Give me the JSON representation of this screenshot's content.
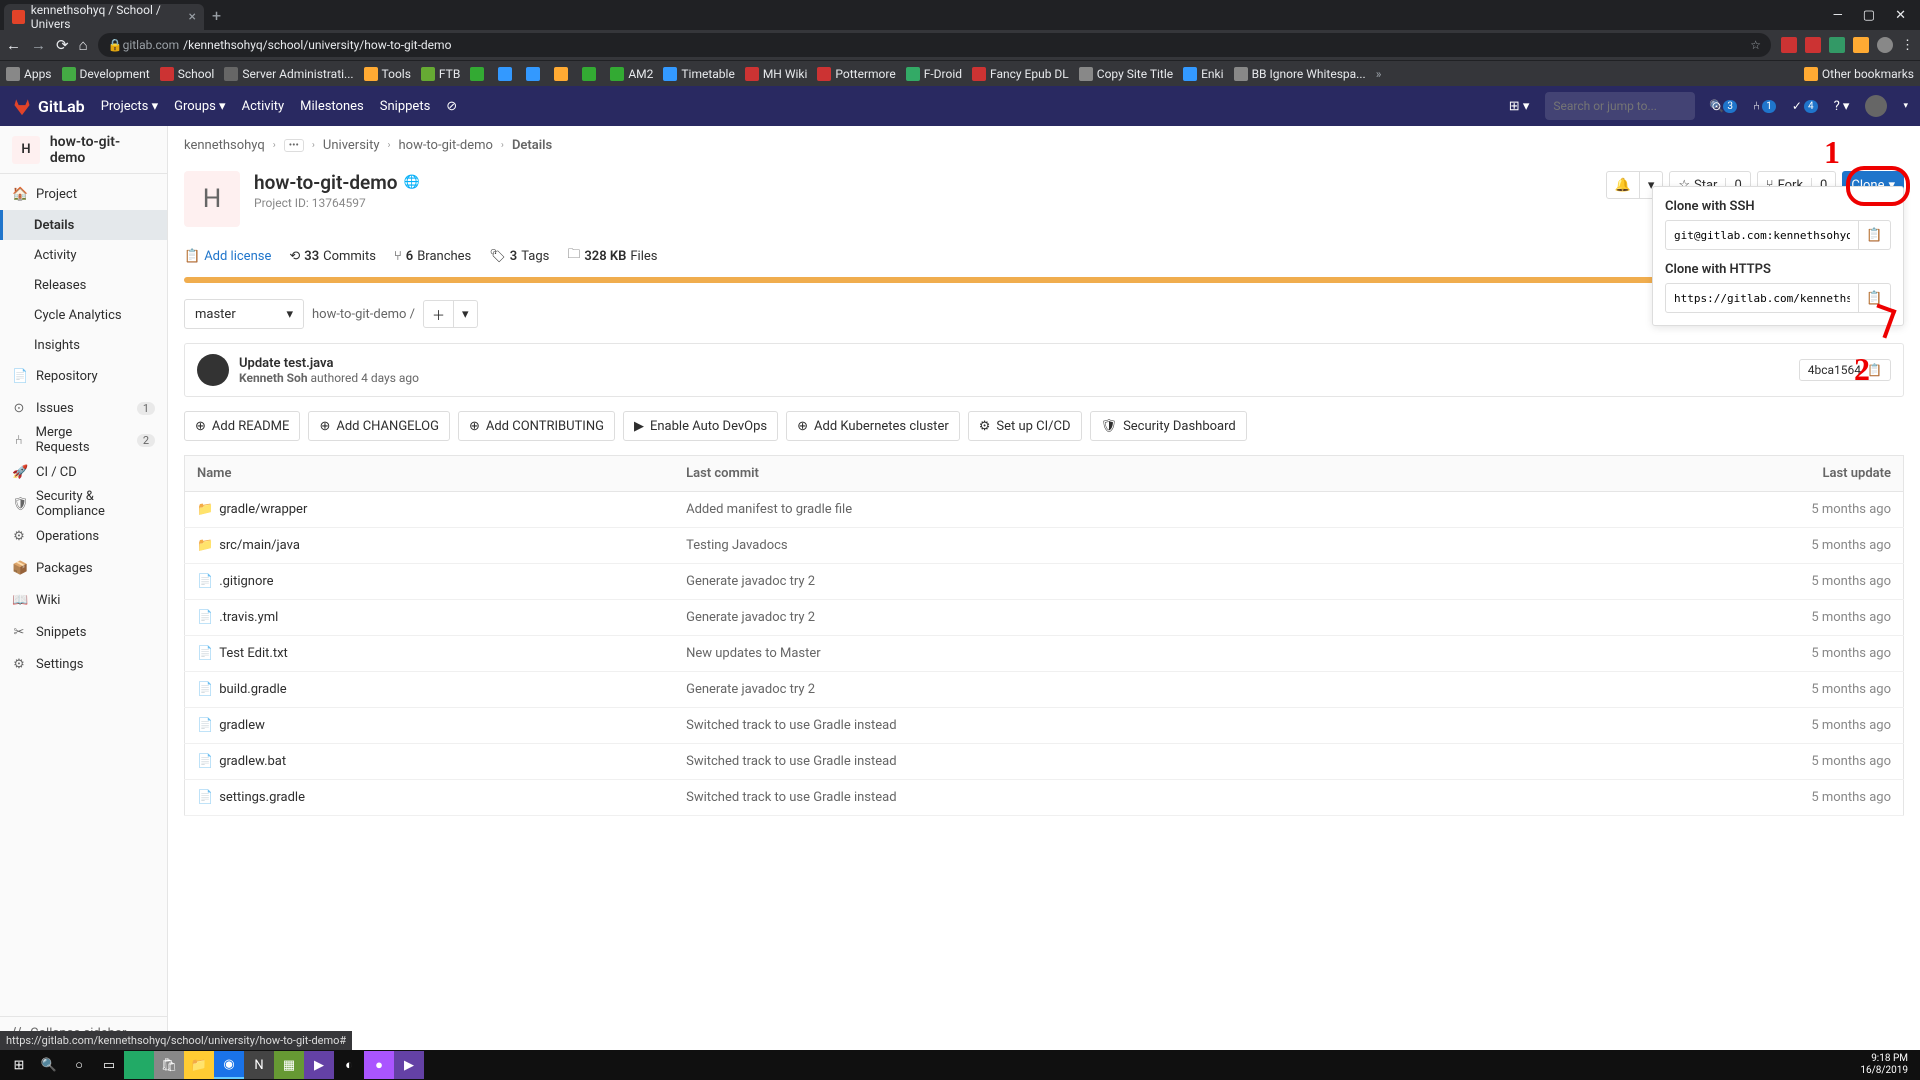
{
  "browser": {
    "tab_title": "kennethsohyq / School / Univers",
    "url_host": "gitlab.com",
    "url_path": "/kennethsohyq/school/university/how-to-git-demo",
    "bookmarks": [
      "Apps",
      "Development",
      "School",
      "Server Administrati...",
      "Tools",
      "FTB",
      "",
      "",
      "",
      "",
      "",
      "AM2",
      "Timetable",
      "MH Wiki",
      "Pottermore",
      "F-Droid",
      "Fancy Epub DL",
      "Copy Site Title",
      "Enki",
      "BB Ignore Whitespa..."
    ],
    "other_bookmarks": "Other bookmarks",
    "status_url": "https://gitlab.com/kennethsohyq/school/university/how-to-git-demo#"
  },
  "gl_header": {
    "brand": "GitLab",
    "nav": [
      "Projects",
      "Groups",
      "Activity",
      "Milestones",
      "Snippets"
    ],
    "search_placeholder": "Search or jump to...",
    "issues_count": "3",
    "mr_count": "1",
    "todo_count": "4"
  },
  "sidebar": {
    "project_initial": "H",
    "project_name": "how-to-git-demo",
    "items": [
      {
        "label": "Project",
        "icon": "🏠"
      },
      {
        "label": "Details",
        "sub": true,
        "active": true
      },
      {
        "label": "Activity",
        "sub": true
      },
      {
        "label": "Releases",
        "sub": true
      },
      {
        "label": "Cycle Analytics",
        "sub": true
      },
      {
        "label": "Insights",
        "sub": true
      },
      {
        "label": "Repository",
        "icon": "📄"
      },
      {
        "label": "Issues",
        "icon": "⊙",
        "badge": "1"
      },
      {
        "label": "Merge Requests",
        "icon": "⑃",
        "badge": "2"
      },
      {
        "label": "CI / CD",
        "icon": "🚀"
      },
      {
        "label": "Security & Compliance",
        "icon": "🛡"
      },
      {
        "label": "Operations",
        "icon": "⚙"
      },
      {
        "label": "Packages",
        "icon": "📦"
      },
      {
        "label": "Wiki",
        "icon": "📖"
      },
      {
        "label": "Snippets",
        "icon": "✂"
      },
      {
        "label": "Settings",
        "icon": "⚙"
      }
    ],
    "collapse": "Collapse sidebar"
  },
  "breadcrumbs": [
    "kennethsohyq",
    "...",
    "University",
    "how-to-git-demo",
    "Details"
  ],
  "project": {
    "initial": "H",
    "title": "how-to-git-demo",
    "id": "Project ID: 13764597",
    "star": "Star",
    "star_count": "0",
    "fork": "Fork",
    "fork_count": "0",
    "clone": "Clone",
    "notification_icon": "🔔"
  },
  "stats": {
    "add_license": "Add license",
    "commits_n": "33",
    "commits_l": "Commits",
    "branches_n": "6",
    "branches_l": "Branches",
    "tags_n": "3",
    "tags_l": "Tags",
    "size_n": "328 KB",
    "size_l": "Files"
  },
  "tree": {
    "branch": "master",
    "crumb": "how-to-git-demo",
    "sep": "/"
  },
  "commit": {
    "msg": "Update test.java",
    "author": "Kenneth Soh",
    "verb": "authored",
    "when": "4 days ago",
    "sha": "4bca1564"
  },
  "quick_actions": [
    "Add README",
    "Add CHANGELOG",
    "Add CONTRIBUTING",
    "Enable Auto DevOps",
    "Add Kubernetes cluster",
    "Set up CI/CD",
    "Security Dashboard"
  ],
  "table": {
    "headers": [
      "Name",
      "Last commit",
      "Last update"
    ],
    "rows": [
      {
        "icon": "📁",
        "name": "gradle/wrapper",
        "commit": "Added manifest to gradle file",
        "when": "5 months ago"
      },
      {
        "icon": "📁",
        "name": "src/main/java",
        "commit": "Testing Javadocs",
        "when": "5 months ago"
      },
      {
        "icon": "📄",
        "name": ".gitignore",
        "commit": "Generate javadoc try 2",
        "when": "5 months ago"
      },
      {
        "icon": "📄",
        "name": ".travis.yml",
        "commit": "Generate javadoc try 2",
        "when": "5 months ago"
      },
      {
        "icon": "📄",
        "name": "Test Edit.txt",
        "commit": "New updates to Master",
        "when": "5 months ago"
      },
      {
        "icon": "📄",
        "name": "build.gradle",
        "commit": "Generate javadoc try 2",
        "when": "5 months ago"
      },
      {
        "icon": "📄",
        "name": "gradlew",
        "commit": "Switched track to use Gradle instead",
        "when": "5 months ago"
      },
      {
        "icon": "📄",
        "name": "gradlew.bat",
        "commit": "Switched track to use Gradle instead",
        "when": "5 months ago"
      },
      {
        "icon": "📄",
        "name": "settings.gradle",
        "commit": "Switched track to use Gradle instead",
        "when": "5 months ago"
      }
    ]
  },
  "clone_dd": {
    "ssh_label": "Clone with SSH",
    "ssh_url": "git@gitlab.com:kennethsohyq/sch",
    "https_label": "Clone with HTTPS",
    "https_url": "https://gitlab.com/kennethsohyq"
  },
  "taskbar": {
    "time": "9:18 PM",
    "date": "16/8/2019"
  },
  "anno": {
    "n1": "1",
    "n2": "2"
  }
}
